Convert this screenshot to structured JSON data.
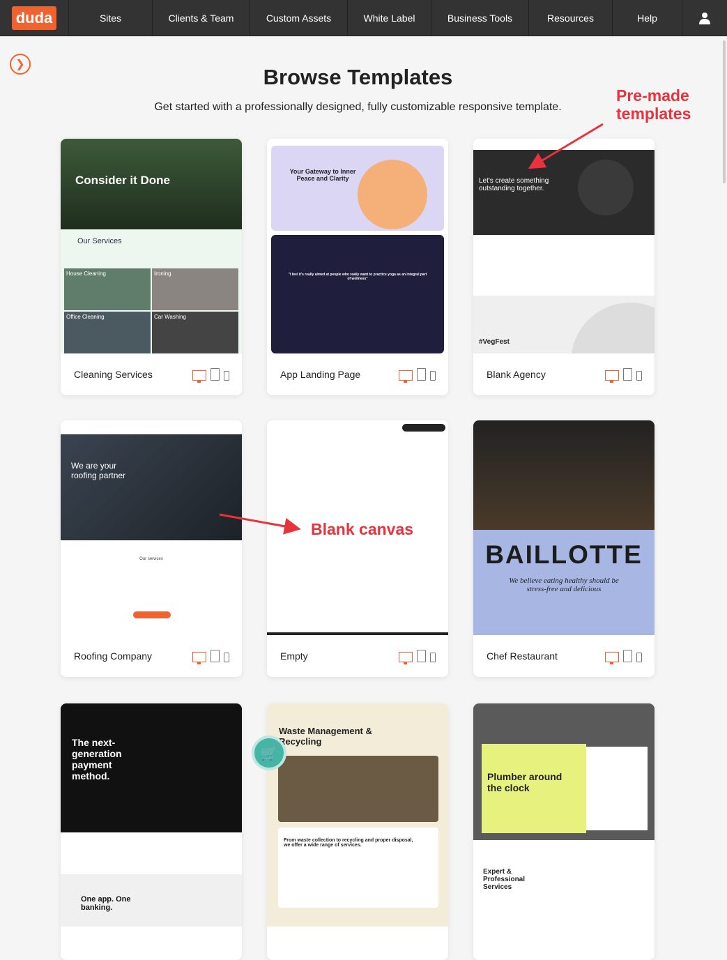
{
  "nav": {
    "logo": "duda",
    "items": [
      "Sites",
      "Clients & Team",
      "Custom Assets",
      "White Label",
      "Business Tools",
      "Resources",
      "Help"
    ]
  },
  "page": {
    "title": "Browse Templates",
    "subtitle": "Get started with a professionally designed, fully customizable responsive template."
  },
  "annotations": {
    "premade": "Pre-made templates",
    "blank": "Blank canvas",
    "color": "#e8323c"
  },
  "accent": "#f2622e",
  "templates": [
    {
      "name": "Cleaning Services",
      "headline": "Consider it Done",
      "section": "Our Services",
      "extra": [
        "House Cleaning",
        "Ironing",
        "Office Cleaning",
        "Car Washing"
      ]
    },
    {
      "name": "App Landing Page",
      "headline": "Your Gateway to Inner Peace and Clarity",
      "section": "\"I feel it's really aimed at people who really want to practice yoga as an integral part of wellness\""
    },
    {
      "name": "Blank Agency",
      "headline": "Let's create something outstanding together.",
      "section": "#VegFest"
    },
    {
      "name": "Roofing Company",
      "headline": "We are your roofing partner",
      "section": "Our services"
    },
    {
      "name": "Empty",
      "headline": "",
      "section": ""
    },
    {
      "name": "Chef Restaurant",
      "headline": "BAILLOTTE",
      "section": "We believe eating healthy should be stress-free and delicious"
    },
    {
      "name": "",
      "headline": "The next-generation payment method.",
      "section": "One app. One banking."
    },
    {
      "name": "",
      "headline": "Waste Management & Recycling",
      "section": "From waste collection to recycling and proper disposal, we offer a wide range of services."
    },
    {
      "name": "",
      "headline": "Plumber around the clock",
      "section": "Expert & Professional Services"
    }
  ]
}
